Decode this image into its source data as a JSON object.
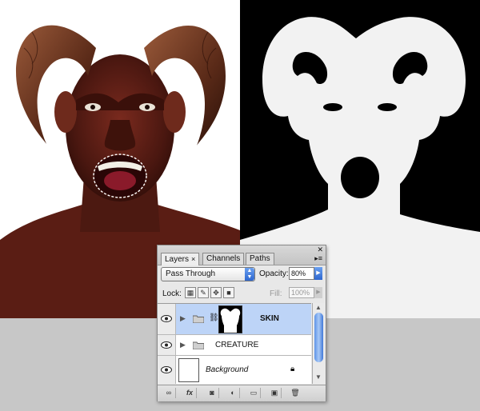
{
  "layers_panel": {
    "tabs": [
      {
        "label": "Layers",
        "close": "×"
      },
      {
        "label": "Channels"
      },
      {
        "label": "Paths"
      }
    ],
    "blend_mode": "Pass Through",
    "opacity_label": "Opacity:",
    "opacity_value": "80%",
    "lock_label": "Lock:",
    "fill_label": "Fill:",
    "fill_value": "100%",
    "layers": [
      {
        "name": "SKIN",
        "type": "group",
        "selected": true,
        "visible": true
      },
      {
        "name": "CREATURE",
        "type": "group",
        "selected": false,
        "visible": true
      },
      {
        "name": "Background",
        "type": "layer",
        "selected": false,
        "visible": true,
        "locked": true
      }
    ],
    "bottom_buttons": [
      "link-layers-icon",
      "fx-icon",
      "add-mask-icon",
      "adjustment-icon",
      "new-group-icon",
      "new-layer-icon",
      "trash-icon"
    ],
    "fx_label": "fx",
    "accent_color": "#bdd4f7"
  }
}
